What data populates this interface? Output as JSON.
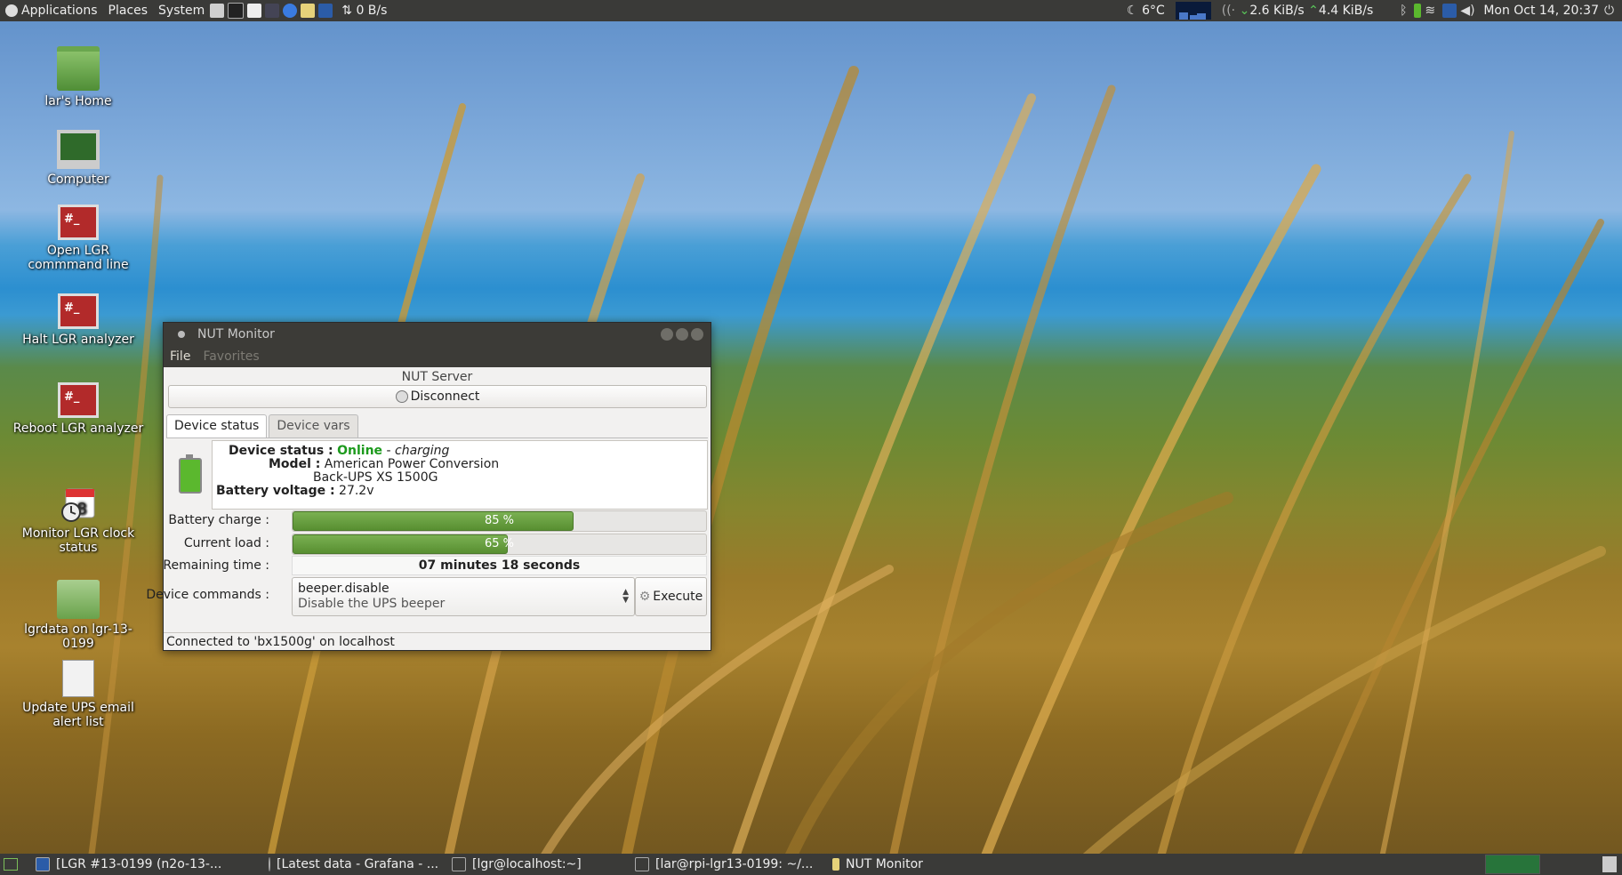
{
  "top_panel": {
    "menus": [
      "Applications",
      "Places",
      "System"
    ],
    "net_speed_left": "0 B/s",
    "weather": "6°C",
    "down_speed": "2.6 KiB/s",
    "up_speed": "4.4 KiB/s",
    "clock": "Mon Oct 14, 20:37",
    "icons": [
      "ubuntu-logo-icon",
      "file-manager-icon",
      "terminal-icon",
      "text-editor-icon",
      "calculator-icon",
      "chromium-icon",
      "files-icon",
      "vnc-icon",
      "network-icon",
      "moon-icon",
      "cpu-graph-icon",
      "wifi-icon",
      "bluetooth-icon",
      "battery-icon",
      "volume-icon",
      "power-icon"
    ]
  },
  "desktop_icons": [
    {
      "label": "lar's Home",
      "icon": "home-folder-icon"
    },
    {
      "label": "Computer",
      "icon": "computer-icon"
    },
    {
      "label": "Open LGR commmand line",
      "icon": "terminal-icon"
    },
    {
      "label": "Halt LGR analyzer",
      "icon": "terminal-icon"
    },
    {
      "label": "Reboot LGR analyzer",
      "icon": "terminal-icon"
    },
    {
      "label": "Monitor LGR clock status",
      "icon": "calendar-clock-icon",
      "badge": "8"
    },
    {
      "label": "lgrdata on lgr-13-0199",
      "icon": "network-share-icon"
    },
    {
      "label": "Update UPS email alert list",
      "icon": "edit-document-icon"
    }
  ],
  "window": {
    "title": "NUT Monitor",
    "menu": {
      "file": "File",
      "favorites": "Favorites"
    },
    "server_section": "NUT Server",
    "disconnect_label": "Disconnect",
    "tabs": {
      "device_status": "Device status",
      "device_vars": "Device vars"
    },
    "status": {
      "device_status_label": "Device status :",
      "device_status_value": "Online",
      "device_status_sep": " - ",
      "device_status_extra": "charging",
      "model_label": "Model :",
      "model_line1": "American Power Conversion",
      "model_line2": "Back-UPS XS 1500G",
      "voltage_label": "Battery voltage :",
      "voltage_value": "27.2v"
    },
    "battery_charge": {
      "label": "Battery charge :",
      "value": 85,
      "text": "85 %"
    },
    "current_load": {
      "label": "Current load :",
      "value": 65,
      "text": "65 %"
    },
    "remaining": {
      "label": "Remaining time :",
      "value": "07 minutes 18 seconds"
    },
    "commands": {
      "label": "Device commands :",
      "selected": "beeper.disable",
      "description": "Disable the UPS beeper",
      "execute_label": "Execute"
    },
    "statusbar": "Connected to 'bx1500g' on localhost"
  },
  "taskbar": [
    {
      "label": "[LGR #13-0199 (n2o-13-...",
      "icon": "vnc-icon"
    },
    {
      "label": "[Latest data - Grafana - ...",
      "icon": "chromium-icon"
    },
    {
      "label": "[lgr@localhost:~]",
      "icon": "terminal-icon"
    },
    {
      "label": "[lar@rpi-lgr13-0199: ~/...",
      "icon": "terminal-icon"
    },
    {
      "label": "NUT Monitor",
      "icon": "nut-monitor-icon"
    }
  ],
  "colors": {
    "panel": "#3a3a38",
    "online_green": "#1d9a1d",
    "progress_green": "#6aa043",
    "titlebar": "#3c3b37"
  }
}
